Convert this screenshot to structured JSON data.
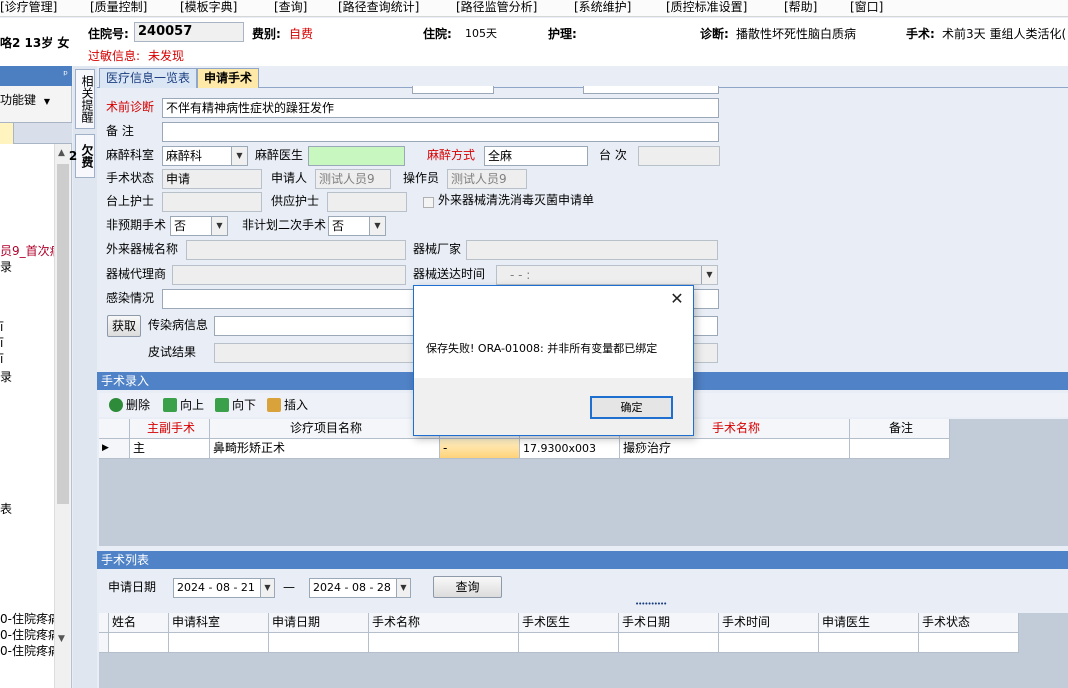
{
  "menu": [
    "[诊疗管理]",
    "[质量控制]",
    "[模板字典]",
    "[查询]",
    "[路径查询统计]",
    "[路径监管分析]",
    "[系统维护]",
    "[质控标准设置]",
    "[帮助]",
    "[窗口]"
  ],
  "patient": {
    "age_sex": "咯2 13岁 女",
    "inpatient_no_label": "住院号:",
    "inpatient_no": "240057",
    "fee_type_label": "费别:",
    "fee_type": "自费",
    "stay_label": "住院:",
    "stay_days": "105天",
    "nursing_label": "护理:",
    "diagnosis_label": "诊断:",
    "diagnosis": "播散性坏死性脑白质病",
    "surgery_label": "手术:",
    "surgery": "术前3天  重组人类活化(",
    "allergy_label": "过敏信息:",
    "allergy": "未发现"
  },
  "left_panel": {
    "pin": "ᵖ",
    "func_button": "功能键",
    "entries": [
      "员9_首次病",
      "录",
      "ī",
      "ī",
      "ī",
      "录",
      "表",
      "0-住院疼痛",
      "0-住院疼痛",
      "0-住院疼痛"
    ]
  },
  "side_tabs": [
    "相关提醒",
    "欠费2"
  ],
  "tabs": [
    "医疗信息一览表",
    "申请手术"
  ],
  "form": {
    "preop_diag_label": "术前诊断",
    "preop_diag": "不伴有精神病性症状的躁狂发作",
    "note_label": "备    注",
    "note": "",
    "anes_dept_label": "麻醉科室",
    "anes_dept": "麻醉科",
    "anes_doctor_label": "麻醉医生",
    "anes_method_label": "麻醉方式",
    "anes_method": "全麻",
    "sequence_label": "台 次",
    "status_label": "手术状态",
    "status": "申请",
    "applicant_label": "申请人",
    "applicant": "测试人员9",
    "operator_label": "操作员",
    "operator": "测试人员9",
    "scrub_nurse_label": "台上护士",
    "supply_nurse_label": "供应护士",
    "external_clean_label": "外来器械清洗消毒灭菌申请单",
    "non_planned_label": "非预期手术",
    "non_planned": "否",
    "unplanned_second_label": "非计划二次手术",
    "unplanned_second": "否",
    "ext_device_name_label": "外来器械名称",
    "device_maker_label": "器械厂家",
    "device_agent_label": "器械代理商",
    "device_delivery_label": "器械送达时间",
    "device_delivery_placeholder": "-  -     :",
    "infection_label": "感染情况",
    "fetch_button": "获取",
    "contagious_label": "传染病信息",
    "skin_test_label": "皮试结果"
  },
  "surgery_entry": {
    "header": "手术录入",
    "toolbar": [
      "删除",
      "向上",
      "向下",
      "插入"
    ],
    "columns": [
      "",
      "主副手术",
      "诊疗项目名称",
      "",
      "",
      "手术名称",
      "备注"
    ],
    "rows": [
      {
        "indicator": "▶",
        "type": "主",
        "item": "鼻畸形矫正术",
        "code": "-",
        "value": "17.9300x003",
        "name": "撮痧治疗",
        "note": ""
      }
    ]
  },
  "surgery_list": {
    "header": "手术列表",
    "date_label": "申请日期",
    "date_from": "2024 - 08 - 21",
    "date_sep": "—",
    "date_to": "2024 - 08 - 28",
    "query_button": "查询",
    "splitter": "••••••••••",
    "columns": [
      "姓名",
      "申请科室",
      "申请日期",
      "手术名称",
      "手术医生",
      "手术日期",
      "手术时间",
      "申请医生",
      "手术状态"
    ]
  },
  "dialog": {
    "close": "✕",
    "message": "保存失败! ORA-01008: 并非所有变量都已绑定",
    "ok": "确定"
  }
}
